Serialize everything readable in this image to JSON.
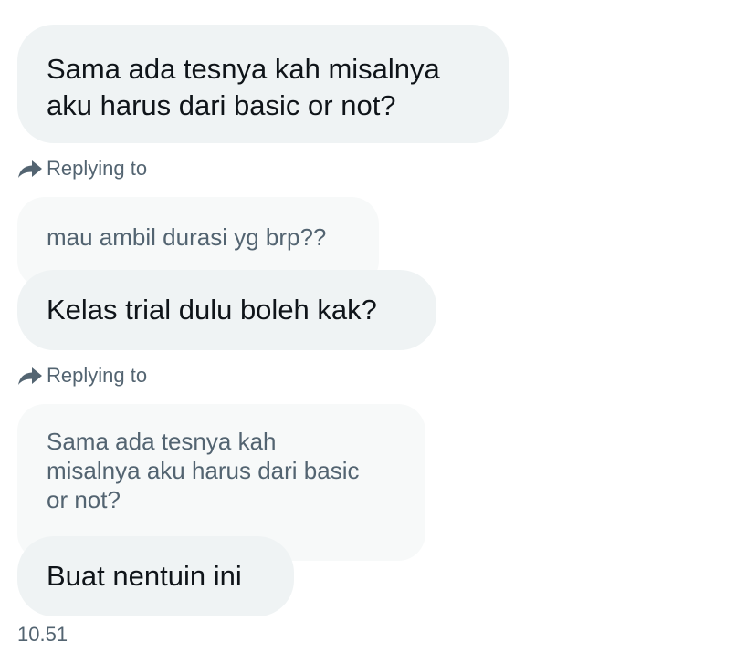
{
  "messages": [
    {
      "type": "message",
      "text": "Sama ada tesnya kah misalnya\naku harus dari basic or not?"
    },
    {
      "type": "reply_label",
      "icon": "reply-arrow-icon",
      "text": "Replying to"
    },
    {
      "type": "quoted",
      "text": "mau ambil durasi yg brp??"
    },
    {
      "type": "message",
      "text": "Kelas trial dulu boleh kak?"
    },
    {
      "type": "reply_label",
      "icon": "reply-arrow-icon",
      "text": "Replying to"
    },
    {
      "type": "quoted",
      "text": "Sama ada tesnya kah\nmisalnya aku harus dari basic\nor not?"
    },
    {
      "type": "message",
      "text": "Buat nentuin ini"
    }
  ],
  "timestamp": "10.51",
  "colors": {
    "bubble_bg": "#eff3f4",
    "quote_bg": "#f7f9f9",
    "text_primary": "#0f1419",
    "text_secondary": "#536471"
  }
}
